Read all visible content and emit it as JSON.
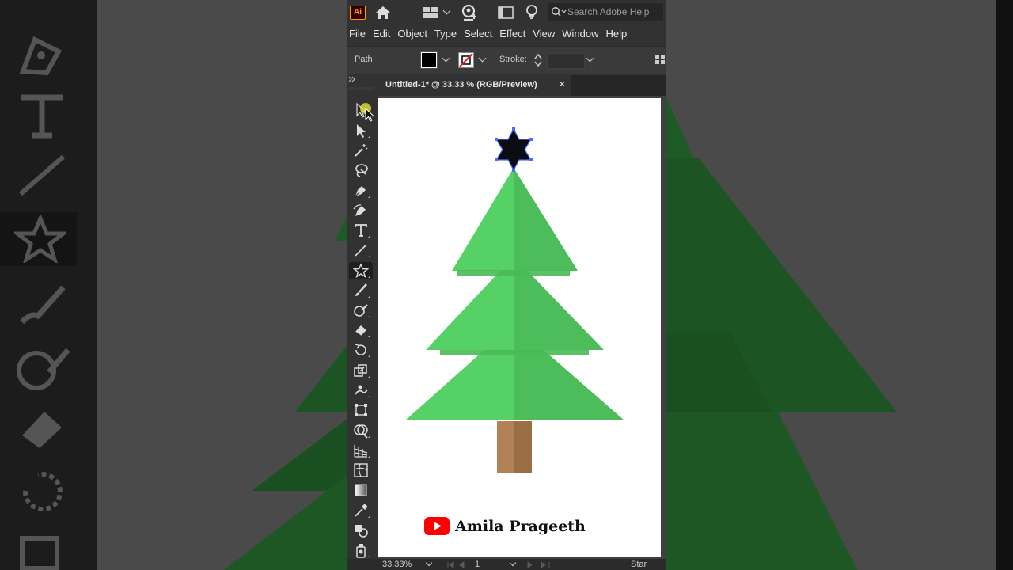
{
  "app": {
    "logo": "Ai",
    "search_placeholder": "Search Adobe Help",
    "menu": [
      "File",
      "Edit",
      "Object",
      "Type",
      "Select",
      "Effect",
      "View",
      "Window",
      "Help"
    ]
  },
  "control_bar": {
    "selection_label": "Path",
    "fill_color": "#000000",
    "stroke_label": "Stroke:"
  },
  "document": {
    "tab_title": "Untitled-1* @ 33.33 % (RGB/Preview)",
    "close_glyph": "×"
  },
  "toolbar": {
    "tools": [
      "selection",
      "direct-selection",
      "magic-wand",
      "lasso",
      "pen",
      "curvature",
      "type",
      "line-segment",
      "star",
      "paintbrush",
      "shaper",
      "eraser",
      "rotate",
      "scale",
      "puppet-warp",
      "free-transform",
      "shape-builder",
      "perspective-grid",
      "mesh",
      "gradient",
      "eyedropper",
      "blend",
      "symbol-sprayer"
    ],
    "active_tool": "star"
  },
  "artwork": {
    "tree_light": "#55d165",
    "tree_dark": "#4cbd5a",
    "trunk_light": "#b08255",
    "trunk_dark": "#9a6f45",
    "star_color": "#0b0b12",
    "credit_text": "Amila Prageeth"
  },
  "status": {
    "zoom": "33.33%",
    "artboard_number": "1",
    "tool_name": "Star"
  }
}
